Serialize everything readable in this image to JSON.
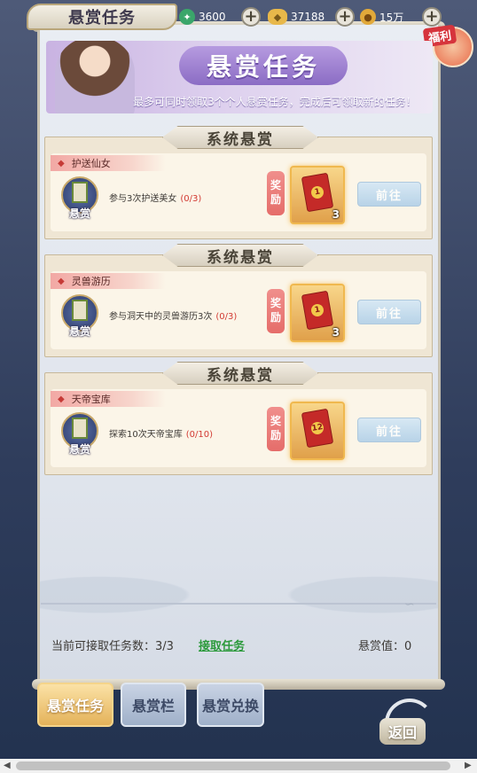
{
  "header": {
    "title": "悬赏任务",
    "resources": [
      {
        "icon": "jade-icon",
        "value": "3600"
      },
      {
        "icon": "ingot-icon",
        "value": "37188"
      },
      {
        "icon": "coin-icon",
        "value": "15万"
      }
    ],
    "fuli_label": "福利"
  },
  "banner": {
    "title": "悬赏任务",
    "description": "最多可同时领取3个个人悬赏任务，完成后可领取新的任务！"
  },
  "sections": [
    {
      "header": "系统悬赏",
      "tag": "护送仙女",
      "icon_label": "悬赏",
      "task": "参与3次护送美女",
      "progress": "(0/3)",
      "reward_label_1": "奖",
      "reward_label_2": "励",
      "reward_count": "3",
      "item_num": "1",
      "button": "前往"
    },
    {
      "header": "系统悬赏",
      "tag": "灵兽游历",
      "icon_label": "悬赏",
      "task": "参与洞天中的灵兽游历3次",
      "progress": "(0/3)",
      "reward_label_1": "奖",
      "reward_label_2": "励",
      "reward_count": "3",
      "item_num": "1",
      "button": "前往"
    },
    {
      "header": "系统悬赏",
      "tag": "天帝宝库",
      "icon_label": "悬赏",
      "task": "探索10次天帝宝库",
      "progress": "(0/10)",
      "reward_label_1": "奖",
      "reward_label_2": "励",
      "reward_count": "",
      "item_num": "12",
      "button": "前往"
    }
  ],
  "footer": {
    "available_text": "当前可接取任务数：3/3",
    "accept_link": "接取任务",
    "bounty_value": "悬赏值：0"
  },
  "tabs": [
    {
      "label": "悬赏任务",
      "active": true
    },
    {
      "label": "悬赏栏",
      "active": false
    },
    {
      "label": "悬赏兑换",
      "active": false
    }
  ],
  "back_label": "返回"
}
